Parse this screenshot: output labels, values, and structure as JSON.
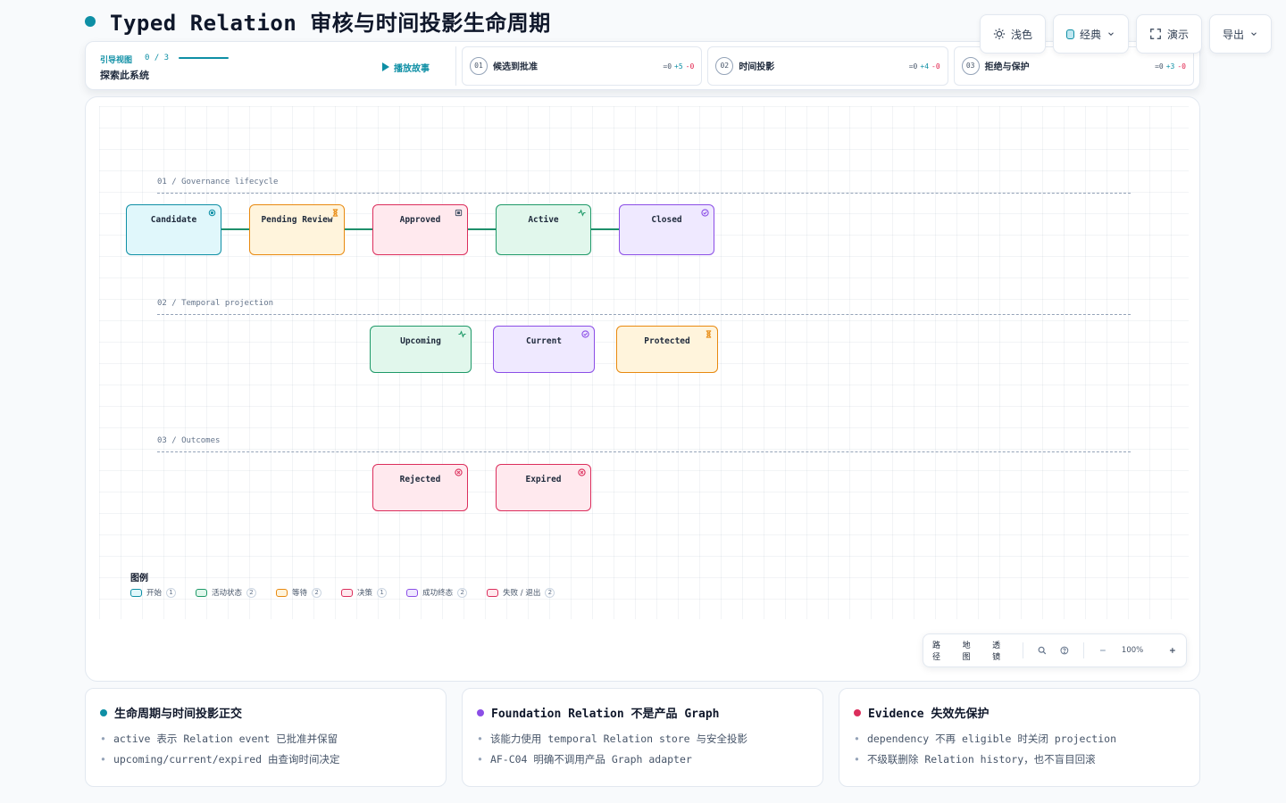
{
  "title": "Typed Relation 审核与时间投影生命周期",
  "toolbar": {
    "theme_label": "浅色",
    "style_label": "经典",
    "present_label": "演示",
    "export_label": "导出"
  },
  "story": {
    "label": "引导视图",
    "progress": "0 / 3",
    "subtitle": "探索此系统",
    "play_label": "播放故事",
    "steps": [
      {
        "num": "01",
        "label": "候选到批准",
        "eq": "=0",
        "plus": "+5",
        "minus": "-0"
      },
      {
        "num": "02",
        "label": "时间投影",
        "eq": "=0",
        "plus": "+4",
        "minus": "-0"
      },
      {
        "num": "03",
        "label": "拒绝与保护",
        "eq": "=0",
        "plus": "+3",
        "minus": "-0"
      }
    ]
  },
  "lanes": [
    {
      "label": "01 / Governance lifecycle"
    },
    {
      "label": "02 / Temporal projection"
    },
    {
      "label": "03 / Outcomes"
    }
  ],
  "nodes": {
    "candidate": "Candidate",
    "pending_review": "Pending Review",
    "approved": "Approved",
    "active": "Active",
    "closed": "Closed",
    "upcoming": "Upcoming",
    "current": "Current",
    "protected": "Protected",
    "rejected": "Rejected",
    "expired": "Expired"
  },
  "colors": {
    "start": "#0e8fa5",
    "active": "#1e9968",
    "wait": "#e8890f",
    "decision": "#db2e5c",
    "success": "#8b4ee6",
    "fail": "#db2e5c"
  },
  "legend": {
    "title": "图例",
    "items": [
      {
        "label": "开始",
        "count": "1"
      },
      {
        "label": "活动状态",
        "count": "2"
      },
      {
        "label": "等待",
        "count": "2"
      },
      {
        "label": "决策",
        "count": "1"
      },
      {
        "label": "成功终态",
        "count": "2"
      },
      {
        "label": "失败 / 退出",
        "count": "2"
      }
    ]
  },
  "controls": {
    "path": "路径",
    "map": "地图",
    "lens": "透镜",
    "zoom": "100%"
  },
  "cards": [
    {
      "title": "生命周期与时间投影正交",
      "dot": "#0e8fa5",
      "items": [
        "active 表示 Relation event 已批准并保留",
        "upcoming/current/expired 由查询时间决定"
      ]
    },
    {
      "title": "Foundation Relation 不是产品 Graph",
      "dot": "#8b4ee6",
      "items": [
        "该能力使用 temporal Relation store 与安全投影",
        "AF-C04 明确不调用产品 Graph adapter"
      ]
    },
    {
      "title": "Evidence 失效先保护",
      "dot": "#db2e5c",
      "items": [
        "dependency 不再 eligible 时关闭 projection",
        "不级联删除 Relation history，也不盲目回滚"
      ]
    }
  ]
}
